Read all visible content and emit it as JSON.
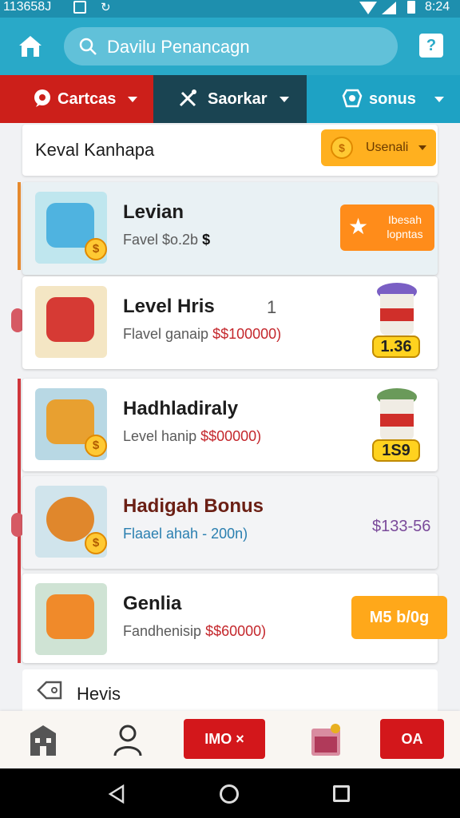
{
  "status_bar": {
    "left_text": "113658J",
    "time": "8:24"
  },
  "app_bar": {
    "search_text": "Davilu Penancagn",
    "help_label": "?"
  },
  "tabs": [
    {
      "label": "Cartcas"
    },
    {
      "label": "Saorkar"
    },
    {
      "label": "sonus"
    }
  ],
  "panel": {
    "title": "Keval Kanhapa",
    "deal_label": "Usenali"
  },
  "cards": [
    {
      "title": "Levian",
      "sub": "Favel $o.2b",
      "sub_extra": "$",
      "cta_label": "Ibesah lopntas"
    },
    {
      "title": "Level Hris",
      "num": "1",
      "sub": "Flavel ganaip",
      "price": "$$100000)",
      "cup_price": "1.36"
    },
    {
      "title": "Hadhladiraly",
      "sub": "Level hanip",
      "price": "$$00000)",
      "cup_price": "1S9"
    },
    {
      "title": "Hadigah Bonus",
      "sub": "Flaael ahah - 200n)",
      "range": "$133-56"
    },
    {
      "title": "Genlia",
      "sub": "Fandhenisip",
      "price": "$$60000)",
      "cta_label": "M5 b/0g"
    }
  ],
  "news": {
    "title": "Hevis"
  },
  "bottom_nav": {
    "btn1_label": "IMO ×",
    "btn2_label": "OA"
  },
  "colors": {
    "app_bar": "#29a9c8",
    "tab_red": "#cc1f1a",
    "tab_dark": "#1a4452",
    "accent_orange": "#ff8c1a",
    "accent_yellow": "#ffa81a",
    "button_red": "#d3171b"
  }
}
